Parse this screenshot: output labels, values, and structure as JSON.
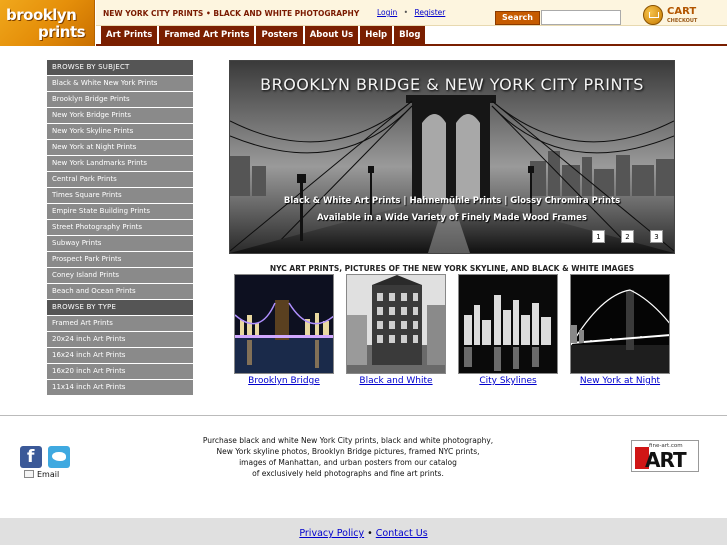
{
  "header": {
    "logo_line1": "brooklyn",
    "logo_line2": "prints",
    "tagline": "NEW YORK CITY PRINTS  •  BLACK AND WHITE PHOTOGRAPHY",
    "login": "Login",
    "separator": "•",
    "register": "Register",
    "search_button": "Search",
    "search_placeholder": "",
    "cart_label": "CART",
    "cart_sub": "CHECKOUT"
  },
  "nav": {
    "items": [
      "Art Prints",
      "Framed Art Prints",
      "Posters",
      "About Us",
      "Help",
      "Blog"
    ]
  },
  "sidebar": {
    "subject_header": "BROWSE BY SUBJECT",
    "subjects": [
      "Black & White New York Prints",
      "Brooklyn Bridge Prints",
      "New York Bridge Prints",
      "New York Skyline Prints",
      "New York at Night Prints",
      "New York Landmarks Prints",
      "Central Park Prints",
      "Times Square Prints",
      "Empire State Building Prints",
      "Street Photography Prints",
      "Subway Prints",
      "Prospect Park Prints",
      "Coney Island Prints",
      "Beach and Ocean Prints"
    ],
    "type_header": "BROWSE BY TYPE",
    "types": [
      "Framed Art Prints",
      "20x24 inch Art Prints",
      "16x24 inch Art Prints",
      "16x20 inch Art Prints",
      "11x14 inch Art Prints"
    ]
  },
  "banner": {
    "title": "BROOKLYN BRIDGE & NEW YORK CITY PRINTS",
    "line1": "Black & White Art Prints  |  Hahnemühle Prints  |  Glossy Chromira Prints",
    "line2": "Available in a Wide Variety of Finely Made Wood Frames",
    "pages": [
      "1",
      "2",
      "3"
    ]
  },
  "gallery": {
    "title": "NYC ART PRINTS, PICTURES OF THE NEW YORK SKYLINE, AND BLACK & WHITE IMAGES",
    "items": [
      "Brooklyn Bridge",
      "Black and White",
      "City Skylines",
      "New York at Night"
    ]
  },
  "footer": {
    "email": "Email",
    "text_lines": [
      "Purchase black and white New York City prints, black and white photography,",
      "New York skyline photos, Brooklyn Bridge pictures, framed NYC prints,",
      "images of Manhattan, and urban posters from our catalog",
      "of exclusively held photographs and fine art prints."
    ],
    "fineart_site": "fine-art.com",
    "fineart_logo": "ART",
    "privacy": "Privacy Policy",
    "link_sep": "•",
    "contact": "Contact Us"
  },
  "colors": {
    "nav_bg": "#7a1f00",
    "sidebar_item": "#8a8a8a",
    "sidebar_header": "#555555",
    "link": "#0000cc",
    "tagline": "#7a1a00"
  }
}
